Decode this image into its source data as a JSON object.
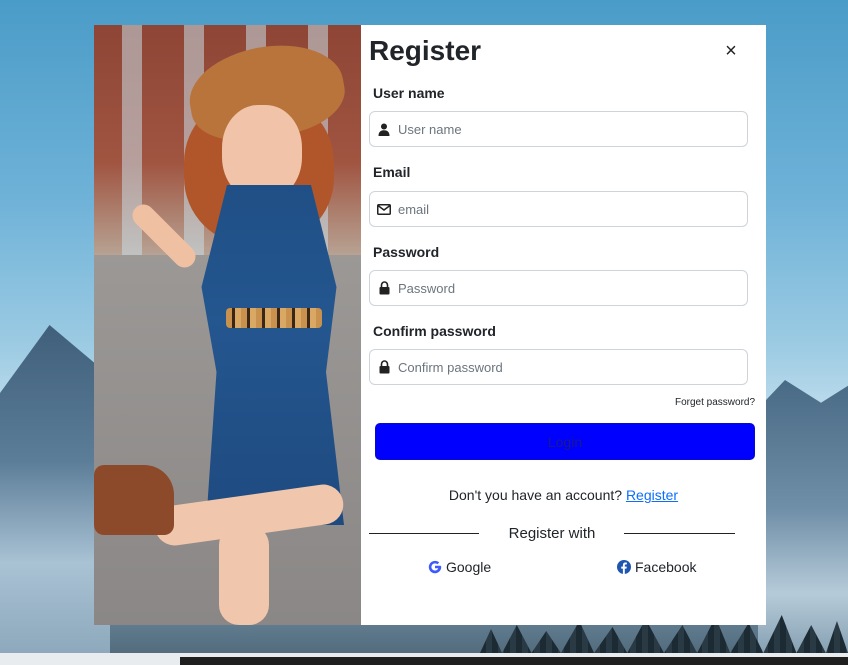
{
  "register_modal": {
    "title": "Register",
    "close_label": "×",
    "fields": [
      {
        "label": "User name",
        "placeholder": "User name",
        "icon": "user-icon"
      },
      {
        "label": "Email",
        "placeholder": "email",
        "icon": "envelope-icon"
      },
      {
        "label": "Password",
        "placeholder": "Password",
        "icon": "lock-icon"
      },
      {
        "label": "Confirm password",
        "placeholder": "Confirm password",
        "icon": "lock-icon"
      }
    ],
    "forget_password": "Forget password?",
    "login_button": "Login",
    "account_prompt": "Don't you have an account?",
    "register_link": "Register",
    "register_with": "Register with",
    "social": {
      "google": "Google",
      "facebook": "Facebook"
    }
  },
  "colors": {
    "login_button": "#0000ff",
    "link": "#0d6efd",
    "google": "#4285f4",
    "facebook": "#1877f2"
  }
}
